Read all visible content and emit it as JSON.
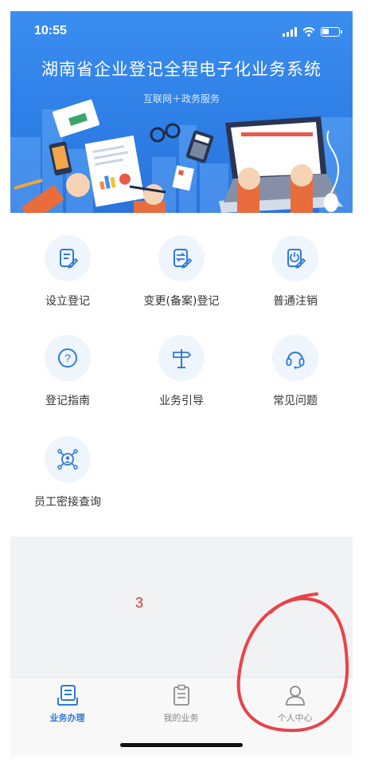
{
  "status_bar": {
    "time": "10:55"
  },
  "banner": {
    "title": "湖南省企业登记全程电子化业务系统",
    "subtitle": "互联网＋政务服务"
  },
  "services": [
    {
      "label": "设立登记",
      "icon": "edit-document-icon"
    },
    {
      "label": "变更(备案)登记",
      "icon": "change-document-icon"
    },
    {
      "label": "普通注销",
      "icon": "power-document-icon"
    },
    {
      "label": "登记指南",
      "icon": "question-circle-icon"
    },
    {
      "label": "业务引导",
      "icon": "signpost-icon"
    },
    {
      "label": "常见问题",
      "icon": "headset-icon"
    },
    {
      "label": "员工密接查询",
      "icon": "contact-trace-icon"
    }
  ],
  "annotation": {
    "number": "3"
  },
  "tabbar": {
    "tabs": [
      {
        "label": "业务办理",
        "icon": "business-handling-icon",
        "active": true
      },
      {
        "label": "我的业务",
        "icon": "clipboard-icon",
        "active": false
      },
      {
        "label": "个人中心",
        "icon": "person-icon",
        "active": false
      }
    ]
  },
  "colors": {
    "banner": "#2e7fe6",
    "accent": "#2f79d8",
    "icon_bg": "#eef5fd",
    "annotation": "#e53030"
  }
}
